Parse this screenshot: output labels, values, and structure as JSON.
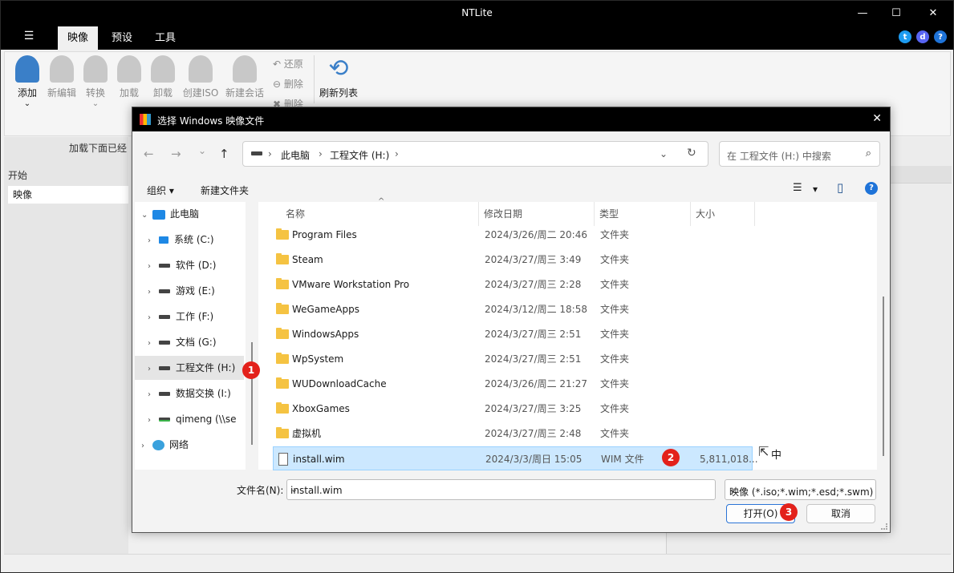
{
  "app": {
    "title": "NTLite",
    "window_controls": {
      "minimize": "—",
      "maximize": "☐",
      "close": "✕"
    },
    "hamburger": "☰",
    "tabs": [
      {
        "label": "映像"
      },
      {
        "label": "预设"
      },
      {
        "label": "工具"
      }
    ],
    "socials": {
      "twitter": "t",
      "discord": "d",
      "help": "?"
    }
  },
  "ribbon": {
    "buttons": [
      {
        "label": "添加"
      },
      {
        "label": "新编辑"
      },
      {
        "label": "转换"
      },
      {
        "label": "加载"
      },
      {
        "label": "卸载"
      },
      {
        "label": "创建ISO"
      },
      {
        "label": "新建会话"
      },
      {
        "label": "刷新列表"
      }
    ],
    "small": [
      {
        "label": "还原"
      },
      {
        "label": "删除"
      },
      {
        "label": "删除"
      }
    ],
    "add_chevron": "⌄",
    "convert_chevron": "⌄"
  },
  "left_pane": {
    "hint": "加载下面已经",
    "header": "开始",
    "item": "映像"
  },
  "dialog": {
    "title": "选择 Windows 映像文件",
    "close": "✕",
    "nav": {
      "back": "←",
      "forward": "→",
      "recent": "⌄",
      "up": "↑"
    },
    "address": {
      "crumbs": [
        "此电脑",
        "工程文件 (H:)"
      ],
      "sep": "›",
      "dropdown": "⌄",
      "refresh": "↻"
    },
    "search_placeholder": "在 工程文件 (H:) 中搜索",
    "search_icon": "⌕",
    "organize": "组织",
    "organize_chevron": "▾",
    "new_folder": "新建文件夹",
    "view_icon": "☰",
    "view_chevron": "▾",
    "preview_icon": "▯",
    "help_icon": "?",
    "tree": [
      {
        "label": "此电脑",
        "chev": "⌄",
        "kind": "pc"
      },
      {
        "label": "系统 (C:)",
        "chev": "›",
        "kind": "drive"
      },
      {
        "label": "软件 (D:)",
        "chev": "›",
        "kind": "drive"
      },
      {
        "label": "游戏 (E:)",
        "chev": "›",
        "kind": "drive"
      },
      {
        "label": "工作 (F:)",
        "chev": "›",
        "kind": "drive"
      },
      {
        "label": "文档 (G:)",
        "chev": "›",
        "kind": "drive"
      },
      {
        "label": "工程文件 (H:)",
        "chev": "›",
        "kind": "drive"
      },
      {
        "label": "数据交换 (I:)",
        "chev": "›",
        "kind": "drive"
      },
      {
        "label": "qimeng (\\\\se",
        "chev": "›",
        "kind": "netdrive"
      },
      {
        "label": "网络",
        "chev": "›",
        "kind": "net"
      }
    ],
    "columns": {
      "name": "名称",
      "date": "修改日期",
      "type": "类型",
      "size": "大小",
      "sort": "^"
    },
    "rows": [
      {
        "name": "Program Files",
        "date": "2024/3/26/周二 20:46",
        "type": "文件夹",
        "size": ""
      },
      {
        "name": "Steam",
        "date": "2024/3/27/周三 3:49",
        "type": "文件夹",
        "size": ""
      },
      {
        "name": "VMware Workstation Pro",
        "date": "2024/3/27/周三 2:28",
        "type": "文件夹",
        "size": ""
      },
      {
        "name": "WeGameApps",
        "date": "2024/3/12/周二 18:58",
        "type": "文件夹",
        "size": ""
      },
      {
        "name": "WindowsApps",
        "date": "2024/3/27/周三 2:51",
        "type": "文件夹",
        "size": ""
      },
      {
        "name": "WpSystem",
        "date": "2024/3/27/周三 2:51",
        "type": "文件夹",
        "size": ""
      },
      {
        "name": "WUDownloadCache",
        "date": "2024/3/26/周二 21:27",
        "type": "文件夹",
        "size": ""
      },
      {
        "name": "XboxGames",
        "date": "2024/3/27/周三 3:25",
        "type": "文件夹",
        "size": ""
      },
      {
        "name": "虚拟机",
        "date": "2024/3/27/周三 2:48",
        "type": "文件夹",
        "size": ""
      },
      {
        "name": "install.wim",
        "date": "2024/3/3/周日 15:05",
        "type": "WIM 文件",
        "size": "5,811,018..."
      }
    ],
    "filename_label": "文件名(N):",
    "filename_value": "install.wim",
    "filetype_value": "映像 (*.iso;*.wim;*.esd;*.swm)",
    "dropdown": "⌄",
    "open_button": "打开(O)",
    "cancel_button": "取消"
  },
  "annotations": [
    "1",
    "2",
    "3"
  ],
  "ime_indicator": "中",
  "cursor": "⇱"
}
